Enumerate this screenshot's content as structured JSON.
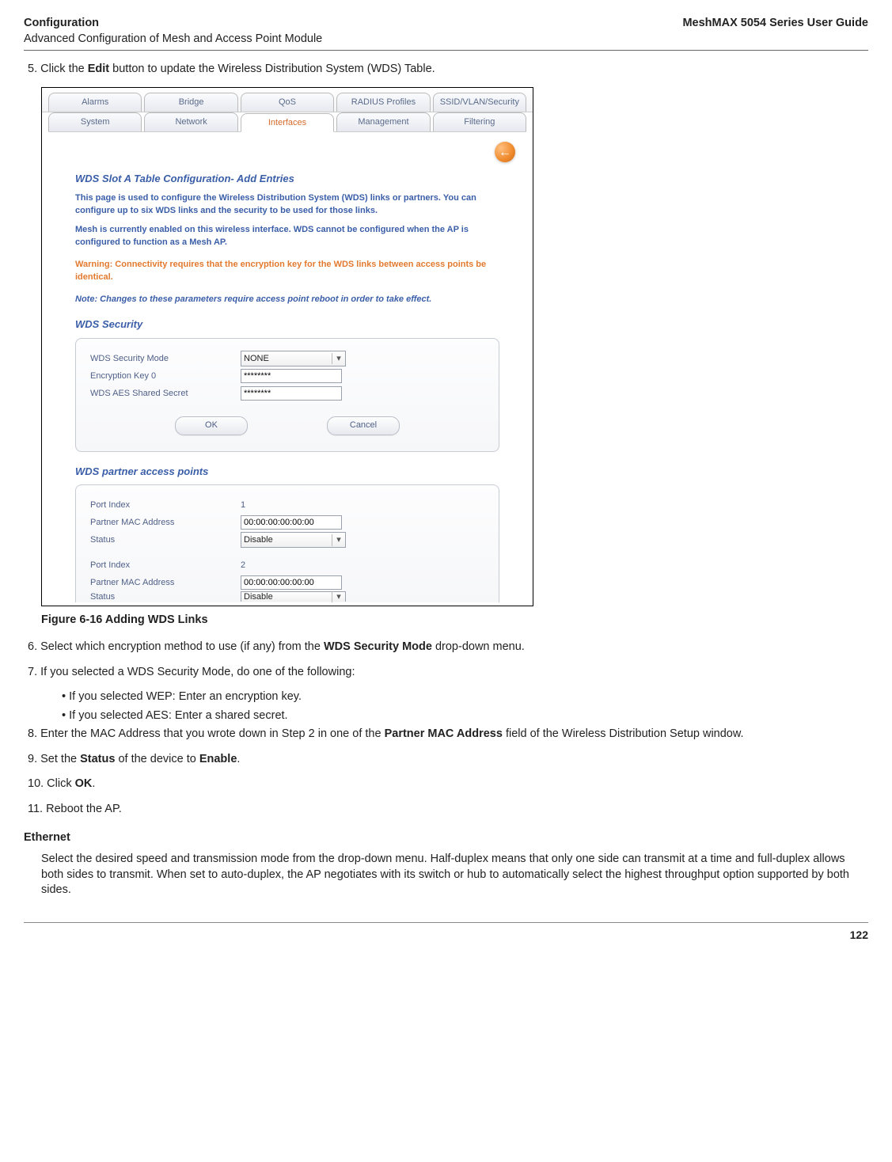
{
  "header": {
    "title": "Configuration",
    "subtitle": "Advanced Configuration of Mesh and Access Point Module",
    "guide": "MeshMAX 5054 Series User Guide"
  },
  "step5": "5.  Click the ",
  "step5b": " button to update the Wireless Distribution System (WDS) Table.",
  "bold_edit": "Edit",
  "tabs_row1": {
    "t0": "Alarms",
    "t1": "Bridge",
    "t2": "QoS",
    "t3": "RADIUS Profiles",
    "t4": "SSID/VLAN/Security"
  },
  "tabs_row2": {
    "t0": "System",
    "t1": "Network",
    "t2": "Interfaces",
    "t3": "Management",
    "t4": "Filtering"
  },
  "back_arrow": "←",
  "sec_title": "WDS Slot A Table Configuration- Add Entries",
  "desc1": "This page is used to configure the Wireless Distribution System (WDS) links or partners. You can configure up to six WDS links and the security to be used for those links.",
  "desc2": "Mesh is currently enabled on this wireless interface. WDS cannot be configured when the AP is configured to function as a Mesh AP.",
  "warn": "Warning: Connectivity requires that the encryption key for the WDS links between access points be identical.",
  "note": "Note: Changes to these parameters require access point reboot in order to take effect.",
  "sec_security": "WDS Security",
  "labels": {
    "mode": "WDS Security Mode",
    "key0": "Encryption Key 0",
    "aes": "WDS AES Shared Secret",
    "port_index": "Port Index",
    "mac": "Partner MAC Address",
    "status": "Status"
  },
  "values": {
    "mode": "NONE",
    "mask": "********",
    "pi1": "1",
    "pi2": "2",
    "mac0": "00:00:00:00:00:00",
    "status_disable": "Disable"
  },
  "btn_ok": "OK",
  "btn_cancel": "Cancel",
  "sec_partners": "WDS partner access points",
  "fig_caption": "Figure 6-16 Adding WDS Links",
  "step6a": "6.  Select which encryption method to use (if any) from the ",
  "bold_wdsmode": "WDS Security Mode",
  "step6b": " drop-down menu.",
  "step7": "7.  If you selected a WDS Security Mode, do one of the following:",
  "bullet_wep": "•    If you selected WEP: Enter an encryption key.",
  "bullet_aes": "•    If you selected AES: Enter a shared secret.",
  "step8a": "8.  Enter the MAC Address that you wrote down in Step 2 in one of the ",
  "bold_partnermac": "Partner MAC Address",
  "step8b": " field of the Wireless Distribution Setup window.",
  "step9a": "9.  Set the ",
  "bold_status": "Status",
  "step9b": " of the device to ",
  "bold_enable": "Enable",
  "step9c": ".",
  "step10a": "10. Click ",
  "bold_ok": "OK",
  "step10b": ".",
  "step11": "11. Reboot the AP.",
  "ethernet_h": "Ethernet",
  "ethernet_p": "Select the desired speed and transmission mode from the drop-down menu. Half-duplex means that only one side can transmit at a time and full-duplex allows both sides to transmit. When set to auto-duplex, the AP negotiates with its switch or hub to automatically select the highest throughput option supported by both sides.",
  "page_num": "122"
}
